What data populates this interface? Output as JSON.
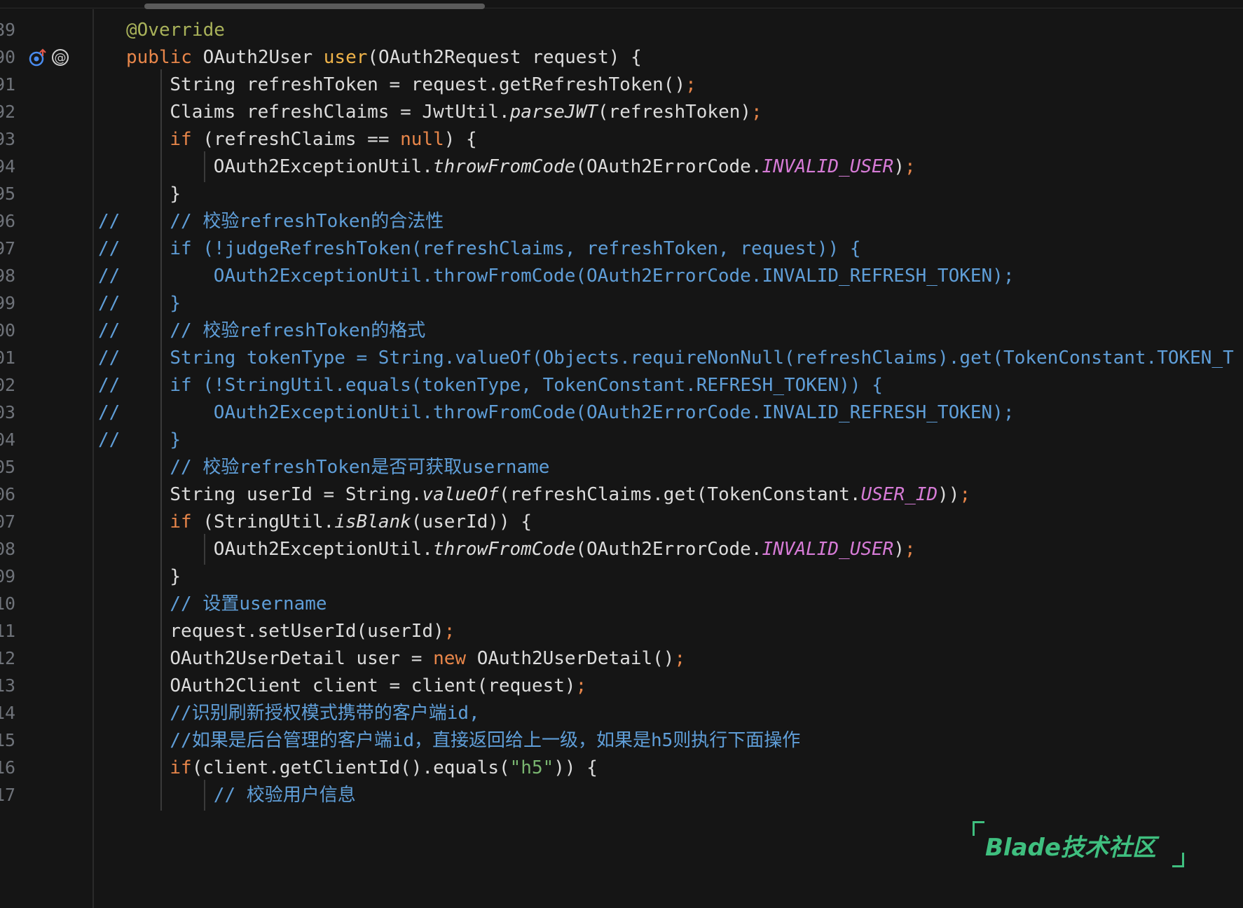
{
  "editor": {
    "lines": [
      {
        "num": "89",
        "icons": [],
        "comment_mark": "",
        "indent": 1,
        "guides": [],
        "tokens": [
          {
            "t": "@Override",
            "c": "ann"
          }
        ]
      },
      {
        "num": "90",
        "icons": [
          "implements-up-icon",
          "at-sign-icon"
        ],
        "comment_mark": "",
        "indent": 1,
        "guides": [],
        "tokens": [
          {
            "t": "public ",
            "c": "kw"
          },
          {
            "t": "OAuth2User ",
            "c": "plain"
          },
          {
            "t": "user",
            "c": "fn"
          },
          {
            "t": "(OAuth2Request request) {",
            "c": "plain"
          }
        ]
      },
      {
        "num": "91",
        "icons": [],
        "comment_mark": "",
        "indent": 2,
        "guides": [
          1
        ],
        "tokens": [
          {
            "t": "String refreshToken = request.getRefreshToken()",
            "c": "plain"
          },
          {
            "t": ";",
            "c": "semi"
          }
        ]
      },
      {
        "num": "92",
        "icons": [],
        "comment_mark": "",
        "indent": 2,
        "guides": [
          1
        ],
        "tokens": [
          {
            "t": "Claims refreshClaims = JwtUtil.",
            "c": "plain"
          },
          {
            "t": "parseJWT",
            "c": "it"
          },
          {
            "t": "(refreshToken)",
            "c": "plain"
          },
          {
            "t": ";",
            "c": "semi"
          }
        ]
      },
      {
        "num": "93",
        "icons": [],
        "comment_mark": "",
        "indent": 2,
        "guides": [
          1
        ],
        "tokens": [
          {
            "t": "if ",
            "c": "kw"
          },
          {
            "t": "(refreshClaims == ",
            "c": "plain"
          },
          {
            "t": "null",
            "c": "kw"
          },
          {
            "t": ") {",
            "c": "plain"
          }
        ]
      },
      {
        "num": "94",
        "icons": [],
        "comment_mark": "",
        "indent": 3,
        "guides": [
          1,
          2
        ],
        "tokens": [
          {
            "t": "OAuth2ExceptionUtil.",
            "c": "plain"
          },
          {
            "t": "throwFromCode",
            "c": "it"
          },
          {
            "t": "(OAuth2ErrorCode.",
            "c": "plain"
          },
          {
            "t": "INVALID_USER",
            "c": "const"
          },
          {
            "t": ")",
            "c": "plain"
          },
          {
            "t": ";",
            "c": "semi"
          }
        ]
      },
      {
        "num": "95",
        "icons": [],
        "comment_mark": "",
        "indent": 2,
        "guides": [
          1
        ],
        "tokens": [
          {
            "t": "}",
            "c": "plain"
          }
        ]
      },
      {
        "num": "96",
        "icons": [],
        "comment_mark": "//",
        "indent": 2,
        "guides": [
          1
        ],
        "tokens": [
          {
            "t": "// 校验refreshToken的合法性",
            "c": "cmt"
          }
        ]
      },
      {
        "num": "97",
        "icons": [],
        "comment_mark": "//",
        "indent": 2,
        "guides": [
          1
        ],
        "tokens": [
          {
            "t": "if (!judgeRefreshToken(refreshClaims, refreshToken, request)) {",
            "c": "cmt"
          }
        ]
      },
      {
        "num": "98",
        "icons": [],
        "comment_mark": "//",
        "indent": 3,
        "guides": [
          1
        ],
        "tokens": [
          {
            "t": "OAuth2ExceptionUtil.throwFromCode(OAuth2ErrorCode.INVALID_REFRESH_TOKEN);",
            "c": "cmt"
          }
        ]
      },
      {
        "num": "99",
        "icons": [],
        "comment_mark": "//",
        "indent": 2,
        "guides": [
          1
        ],
        "tokens": [
          {
            "t": "}",
            "c": "cmt"
          }
        ]
      },
      {
        "num": "00",
        "icons": [],
        "comment_mark": "//",
        "indent": 2,
        "guides": [
          1
        ],
        "tokens": [
          {
            "t": "// 校验refreshToken的格式",
            "c": "cmt"
          }
        ]
      },
      {
        "num": "01",
        "icons": [],
        "comment_mark": "//",
        "indent": 2,
        "guides": [
          1
        ],
        "tokens": [
          {
            "t": "String tokenType = String.valueOf(Objects.requireNonNull(refreshClaims).get(TokenConstant.TOKEN_T",
            "c": "cmt"
          }
        ]
      },
      {
        "num": "02",
        "icons": [],
        "comment_mark": "//",
        "indent": 2,
        "guides": [
          1
        ],
        "tokens": [
          {
            "t": "if (!StringUtil.equals(tokenType, TokenConstant.REFRESH_TOKEN)) {",
            "c": "cmt"
          }
        ]
      },
      {
        "num": "03",
        "icons": [],
        "comment_mark": "//",
        "indent": 3,
        "guides": [
          1
        ],
        "tokens": [
          {
            "t": "OAuth2ExceptionUtil.throwFromCode(OAuth2ErrorCode.INVALID_REFRESH_TOKEN);",
            "c": "cmt"
          }
        ]
      },
      {
        "num": "04",
        "icons": [],
        "comment_mark": "//",
        "indent": 2,
        "guides": [
          1
        ],
        "tokens": [
          {
            "t": "}",
            "c": "cmt"
          }
        ]
      },
      {
        "num": "05",
        "icons": [],
        "comment_mark": "",
        "indent": 2,
        "guides": [
          1
        ],
        "tokens": [
          {
            "t": "// 校验refreshToken是否可获取username",
            "c": "cmt"
          }
        ]
      },
      {
        "num": "06",
        "icons": [],
        "comment_mark": "",
        "indent": 2,
        "guides": [
          1
        ],
        "tokens": [
          {
            "t": "String userId = String.",
            "c": "plain"
          },
          {
            "t": "valueOf",
            "c": "it"
          },
          {
            "t": "(refreshClaims.get(TokenConstant.",
            "c": "plain"
          },
          {
            "t": "USER_ID",
            "c": "const"
          },
          {
            "t": "))",
            "c": "plain"
          },
          {
            "t": ";",
            "c": "semi"
          }
        ]
      },
      {
        "num": "07",
        "icons": [],
        "comment_mark": "",
        "indent": 2,
        "guides": [
          1
        ],
        "tokens": [
          {
            "t": "if ",
            "c": "kw"
          },
          {
            "t": "(StringUtil.",
            "c": "plain"
          },
          {
            "t": "isBlank",
            "c": "it"
          },
          {
            "t": "(userId)) {",
            "c": "plain"
          }
        ]
      },
      {
        "num": "08",
        "icons": [],
        "comment_mark": "",
        "indent": 3,
        "guides": [
          1,
          2
        ],
        "tokens": [
          {
            "t": "OAuth2ExceptionUtil.",
            "c": "plain"
          },
          {
            "t": "throwFromCode",
            "c": "it"
          },
          {
            "t": "(OAuth2ErrorCode.",
            "c": "plain"
          },
          {
            "t": "INVALID_USER",
            "c": "const"
          },
          {
            "t": ")",
            "c": "plain"
          },
          {
            "t": ";",
            "c": "semi"
          }
        ]
      },
      {
        "num": "09",
        "icons": [],
        "comment_mark": "",
        "indent": 2,
        "guides": [
          1
        ],
        "tokens": [
          {
            "t": "}",
            "c": "plain"
          }
        ]
      },
      {
        "num": "10",
        "icons": [],
        "comment_mark": "",
        "indent": 2,
        "guides": [
          1
        ],
        "tokens": [
          {
            "t": "// 设置username",
            "c": "cmt"
          }
        ]
      },
      {
        "num": "11",
        "icons": [],
        "comment_mark": "",
        "indent": 2,
        "guides": [
          1
        ],
        "tokens": [
          {
            "t": "request.setUserId(userId)",
            "c": "plain"
          },
          {
            "t": ";",
            "c": "semi"
          }
        ]
      },
      {
        "num": "12",
        "icons": [],
        "comment_mark": "",
        "indent": 2,
        "guides": [
          1
        ],
        "tokens": [
          {
            "t": "OAuth2UserDetail user = ",
            "c": "plain"
          },
          {
            "t": "new ",
            "c": "kw"
          },
          {
            "t": "OAuth2UserDetail()",
            "c": "plain"
          },
          {
            "t": ";",
            "c": "semi"
          }
        ]
      },
      {
        "num": "13",
        "icons": [],
        "comment_mark": "",
        "indent": 2,
        "guides": [
          1
        ],
        "tokens": [
          {
            "t": "OAuth2Client client = client(request)",
            "c": "plain"
          },
          {
            "t": ";",
            "c": "semi"
          }
        ]
      },
      {
        "num": "14",
        "icons": [],
        "comment_mark": "",
        "indent": 2,
        "guides": [
          1
        ],
        "tokens": [
          {
            "t": "//识别刷新授权模式携带的客户端id,",
            "c": "cmt"
          }
        ]
      },
      {
        "num": "15",
        "icons": [],
        "comment_mark": "",
        "indent": 2,
        "guides": [
          1
        ],
        "tokens": [
          {
            "t": "//如果是后台管理的客户端id，直接返回给上一级，如果是h5则执行下面操作",
            "c": "cmt"
          }
        ]
      },
      {
        "num": "16",
        "icons": [],
        "comment_mark": "",
        "indent": 2,
        "guides": [
          1
        ],
        "tokens": [
          {
            "t": "if",
            "c": "kw"
          },
          {
            "t": "(client.getClientId().equals(",
            "c": "plain"
          },
          {
            "t": "\"h5\"",
            "c": "str"
          },
          {
            "t": ")) {",
            "c": "plain"
          }
        ]
      },
      {
        "num": "17",
        "icons": [],
        "comment_mark": "",
        "indent": 3,
        "guides": [
          1,
          2
        ],
        "tokens": [
          {
            "t": "// 校验用户信息",
            "c": "cmt"
          }
        ]
      }
    ]
  },
  "watermark": {
    "text": "Blade技术社区"
  },
  "colors": {
    "background": "#151515",
    "keyword": "#e8864a",
    "comment": "#5f9ed8",
    "constant": "#d67bd6",
    "annotation": "#a9b25a",
    "method_declaration": "#f0b44a",
    "string": "#79b56f",
    "watermark": "#3fbf7f"
  }
}
